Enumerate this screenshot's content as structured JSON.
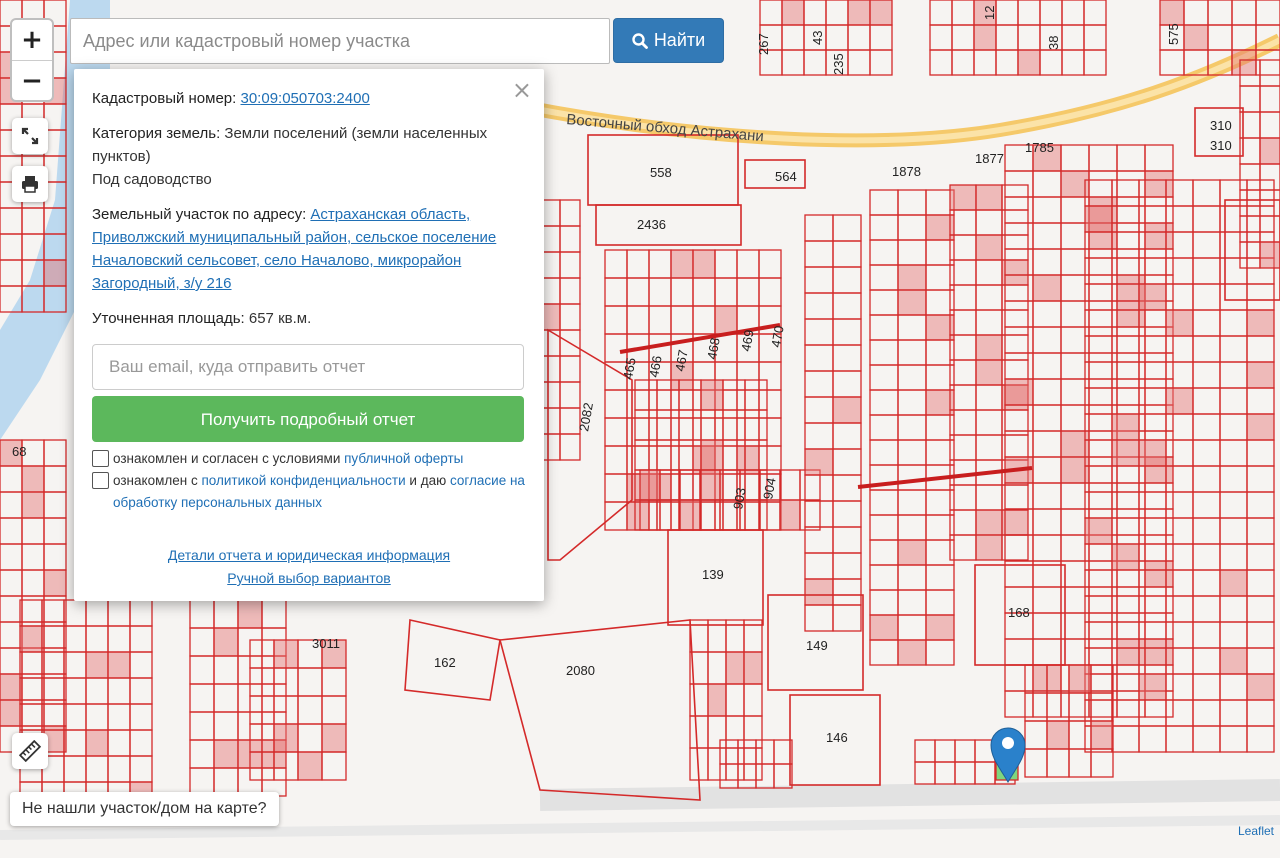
{
  "search": {
    "placeholder": "Адрес или кадастровый номер участка",
    "button_label": "Найти"
  },
  "controls": {
    "zoom_in": "+",
    "zoom_out": "−"
  },
  "popup": {
    "cadastral_label": "Кадастровый номер:",
    "cadastral_number": "30:09:050703:2400",
    "category_label": "Категория земель:",
    "category_value": "Земли поселений (земли населенных пунктов)",
    "use_value": "Под садоводство",
    "address_label": "Земельный участок по адресу:",
    "address_value": "Астраханская область, Приволжский муниципальный район, сельское поселение Началовский сельсовет, село Началово, микрорайон Загородный, з/у 216",
    "area_label": "Уточненная площадь:",
    "area_value": "657 кв.м.",
    "email_placeholder": "Ваш email, куда отправить отчет",
    "report_button": "Получить подробный отчет",
    "consent1_text": "ознакомлен и согласен с условиями",
    "consent1_link": "публичной оферты",
    "consent2_text": "ознакомлен с",
    "consent2_link": "политикой конфиденциальности",
    "consent2_tail": "и даю",
    "consent2_link2": "согласие на обработку персональных данных",
    "details_link": "Детали отчета и юридическая информация",
    "manual_link": "Ручной выбор вариантов"
  },
  "not_found_label": "Не нашли участок/дом на карте?",
  "attribution": "Leaflet",
  "map": {
    "road_name": "Восточный обход Астрахани",
    "parcel_numbers": [
      "558",
      "2436",
      "564",
      "1878",
      "1877",
      "1785",
      "465",
      "466",
      "467",
      "468",
      "469",
      "470",
      "2082",
      "903",
      "904",
      "139",
      "149",
      "146",
      "168",
      "162",
      "2080",
      "310",
      "310",
      "68",
      "3011",
      "267",
      "43",
      "235",
      "38",
      "575",
      "12"
    ],
    "colors": {
      "parcel_line": "#d42a2a",
      "parcel_fill": "#e57373",
      "road": "#f5c96a",
      "water": "#bcd9ef",
      "marker": "#2a81cb",
      "selected": "#7ed67e"
    }
  }
}
